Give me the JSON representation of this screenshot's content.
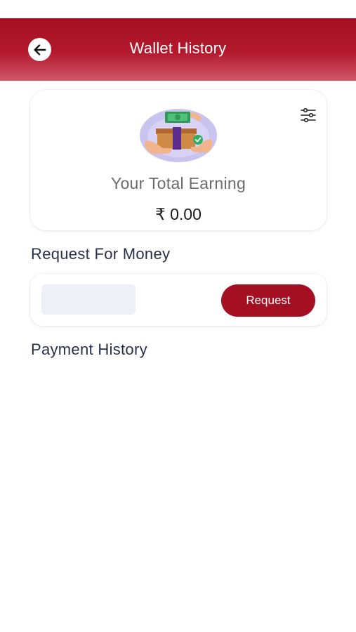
{
  "header": {
    "title": "Wallet History",
    "back_icon": "arrow-left-icon",
    "bg_color": "#a30f22"
  },
  "earning_card": {
    "illustration": "money-delivery-illustration",
    "filter_icon": "sliders-icon",
    "label": "Your Total Earning",
    "amount": "₹ 0.00"
  },
  "request_section": {
    "heading": "Request For Money",
    "input_value": "",
    "button_label": "Request",
    "button_color": "#a40f22"
  },
  "payment_history": {
    "heading": "Payment History",
    "items": []
  }
}
